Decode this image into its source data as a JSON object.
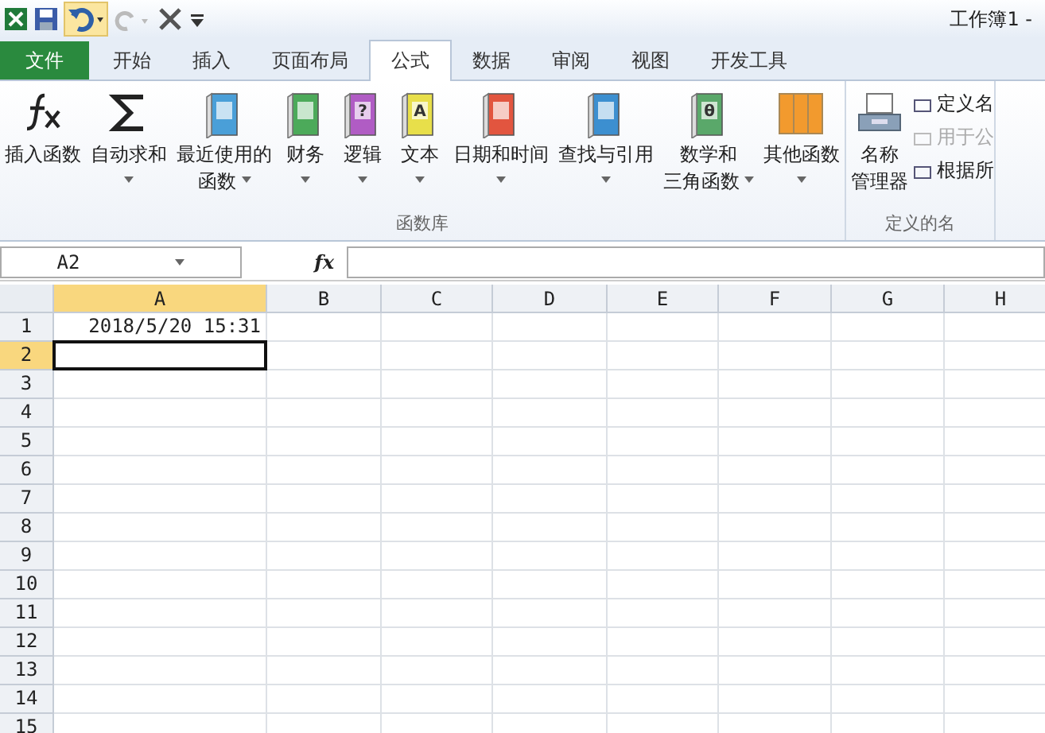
{
  "window": {
    "title": "工作簿1 -"
  },
  "tabs": [
    {
      "label": "文件",
      "kind": "file",
      "selected": false
    },
    {
      "label": "开始",
      "kind": "tab",
      "selected": false
    },
    {
      "label": "插入",
      "kind": "tab",
      "selected": false
    },
    {
      "label": "页面布局",
      "kind": "tab",
      "selected": false
    },
    {
      "label": "公式",
      "kind": "tab",
      "selected": true
    },
    {
      "label": "数据",
      "kind": "tab",
      "selected": false
    },
    {
      "label": "审阅",
      "kind": "tab",
      "selected": false
    },
    {
      "label": "视图",
      "kind": "tab",
      "selected": false
    },
    {
      "label": "开发工具",
      "kind": "tab",
      "selected": false
    }
  ],
  "ribbon": {
    "groups": [
      {
        "label": "函数库",
        "buttons": [
          {
            "lines": [
              "插入函数"
            ],
            "dropdown": false
          },
          {
            "lines": [
              "自动求和"
            ],
            "dropdown": true
          },
          {
            "lines": [
              "最近使用的",
              "函数"
            ],
            "dropdown": true
          },
          {
            "lines": [
              "财务"
            ],
            "dropdown": true
          },
          {
            "lines": [
              "逻辑"
            ],
            "glyph": "?",
            "dropdown": true
          },
          {
            "lines": [
              "文本"
            ],
            "glyph": "A",
            "dropdown": true
          },
          {
            "lines": [
              "日期和时间"
            ],
            "dropdown": true
          },
          {
            "lines": [
              "查找与引用"
            ],
            "dropdown": true
          },
          {
            "lines": [
              "数学和",
              "三角函数"
            ],
            "glyph": "θ",
            "dropdown": true
          },
          {
            "lines": [
              "其他函数"
            ],
            "dropdown": true
          }
        ]
      },
      {
        "label": "定义的名",
        "buttons": [
          {
            "lines": [
              "名称",
              "管理器"
            ],
            "dropdown": false
          }
        ],
        "small": [
          {
            "label": "定义名",
            "disabled": false
          },
          {
            "label": "用于公",
            "disabled": true
          },
          {
            "label": "根据所",
            "disabled": false
          }
        ]
      }
    ]
  },
  "formula_bar": {
    "name_box": "A2",
    "fx": "fx"
  },
  "grid": {
    "columns": [
      {
        "label": "A",
        "selected": true
      },
      {
        "label": "B",
        "selected": false
      },
      {
        "label": "C",
        "selected": false
      },
      {
        "label": "D",
        "selected": false
      },
      {
        "label": "E",
        "selected": false
      },
      {
        "label": "F",
        "selected": false
      },
      {
        "label": "G",
        "selected": false
      },
      {
        "label": "H",
        "selected": false
      }
    ],
    "rows": [
      {
        "label": "1",
        "selected": false,
        "cells": [
          "2018/5/20 15:31"
        ]
      },
      {
        "label": "2",
        "selected": true
      },
      {
        "label": "3",
        "selected": false
      },
      {
        "label": "4",
        "selected": false
      },
      {
        "label": "5",
        "selected": false
      },
      {
        "label": "6",
        "selected": false
      },
      {
        "label": "7",
        "selected": false
      },
      {
        "label": "8",
        "selected": false
      },
      {
        "label": "9",
        "selected": false
      },
      {
        "label": "10",
        "selected": false
      },
      {
        "label": "11",
        "selected": false
      },
      {
        "label": "12",
        "selected": false
      },
      {
        "label": "13",
        "selected": false
      },
      {
        "label": "14",
        "selected": false
      },
      {
        "label": "15",
        "selected": false
      }
    ]
  }
}
